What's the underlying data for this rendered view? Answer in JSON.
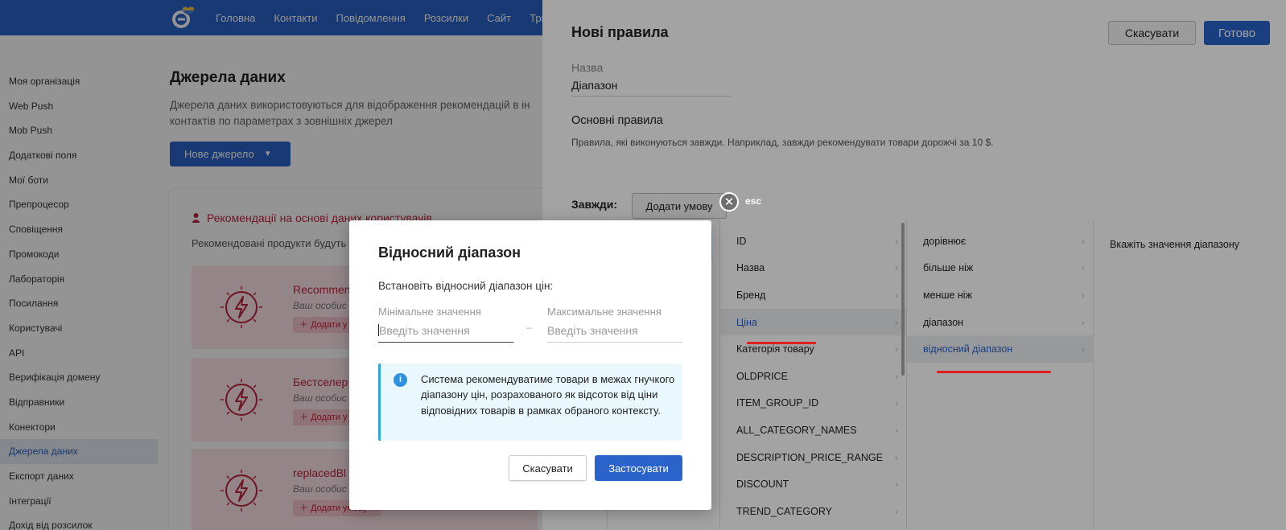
{
  "colors": {
    "brand": "#2a63c9",
    "accent_red": "#c0233d",
    "info_border": "#2fa8d9"
  },
  "topnav": {
    "items": [
      "Головна",
      "Контакти",
      "Повідомлення",
      "Розсилки",
      "Сайт",
      "Тригери"
    ]
  },
  "sidebar": {
    "items": [
      "Моя організація",
      "Web Push",
      "Mob Push",
      "Додаткові поля",
      "Мої боти",
      "Препроцесор",
      "Сповіщення",
      "Промокоди",
      "Лабораторія",
      "Посилання",
      "Користувачі",
      "API",
      "Верифікація домену",
      "Відправники",
      "Конектори",
      "Джерела даних",
      "Експорт даних",
      "Інтеграції",
      "Дохід від розсилок"
    ],
    "active": "Джерела даних"
  },
  "main": {
    "title": "Джерела даних",
    "description_line1": "Джерела даних використовуються для відображення рекомендацій в ін",
    "description_line2": "контактів по параметрах з зовнішніх джерел",
    "new_source_label": "Нове джерело",
    "card": {
      "heading": "Рекомендації на основі даних користувачів",
      "subtitle": "Рекомендовані продукти будуть у",
      "items": [
        {
          "title": "Recommen",
          "subtitle": "Ваш особис",
          "add_label": "Додати у"
        },
        {
          "title": "Бестселер",
          "subtitle": "Ваш особис",
          "add_label": "Додати у"
        },
        {
          "title": "replacedBl",
          "subtitle": "Ваш особис",
          "add_label": "Додати умову"
        }
      ]
    }
  },
  "panel": {
    "title": "Нові правила",
    "cancel_label": "Скасувати",
    "done_label": "Готово",
    "name_label": "Назва",
    "name_value": "Діапазон",
    "basic_rules_title": "Основні правила",
    "basic_rules_desc": "Правила, які виконуються завжди. Наприклад, завжди рекомендувати товари дорожчі за 10 $.",
    "always_label": "Завжди:",
    "add_condition_label": "Додати умову",
    "esc_label": "esc",
    "fields": [
      "ID",
      "Назва",
      "Бренд",
      "Ціна",
      "Категорія товару",
      "OLDPRICE",
      "ITEM_GROUP_ID",
      "ALL_CATEGORY_NAMES",
      "DESCRIPTION_PRICE_RANGE",
      "DISCOUNT",
      "TREND_CATEGORY"
    ],
    "selected_field": "Ціна",
    "operators": [
      "дорівнює",
      "більше ніж",
      "менше ніж",
      "діапазон",
      "відносний діапазон"
    ],
    "selected_operator": "відносний діапазон",
    "value_hint": "Вкажіть значення діапазону"
  },
  "modal": {
    "title": "Відносний діапазон",
    "subtitle": "Встановіть відносний діапазон цін:",
    "min_label": "Мінімальне значення",
    "min_placeholder": "Введіть значення",
    "max_label": "Максимальне значення",
    "max_placeholder": "Введіть значення",
    "dash": "–",
    "info_text": "Система рекомендуватиме товари в межах гнучкого діапазону цін, розрахованого як відсоток від ціни відповідних товарів в рамках обраного контексту.",
    "cancel_label": "Скасувати",
    "apply_label": "Застосувати"
  }
}
